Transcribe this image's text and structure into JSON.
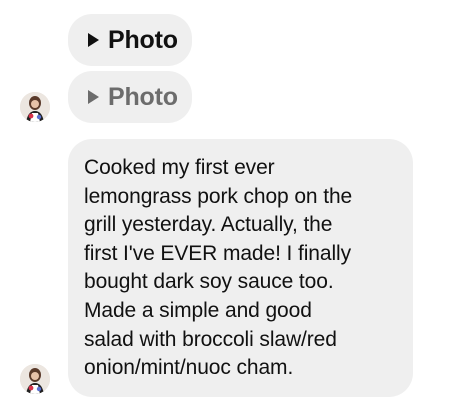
{
  "messages": [
    {
      "type": "photo",
      "label": "Photo",
      "state": "active",
      "icon": "play-icon",
      "color": "#111111"
    },
    {
      "type": "photo",
      "label": "Photo",
      "state": "dimmed",
      "icon": "play-icon",
      "color": "#6c6c6c"
    },
    {
      "type": "text",
      "lines": [
        "Cooked my first ever",
        "lemongrass pork chop on the",
        "grill yesterday. Actually, the",
        "first I've EVER made! I finally",
        "bought dark soy sauce too.",
        "Made a simple and good",
        "salad with broccoli slaw/red",
        "onion/mint/nuoc cham."
      ]
    }
  ],
  "colors": {
    "bubble_bg": "#efefef",
    "text": "#111111",
    "dimmed_text": "#6c6c6c"
  }
}
